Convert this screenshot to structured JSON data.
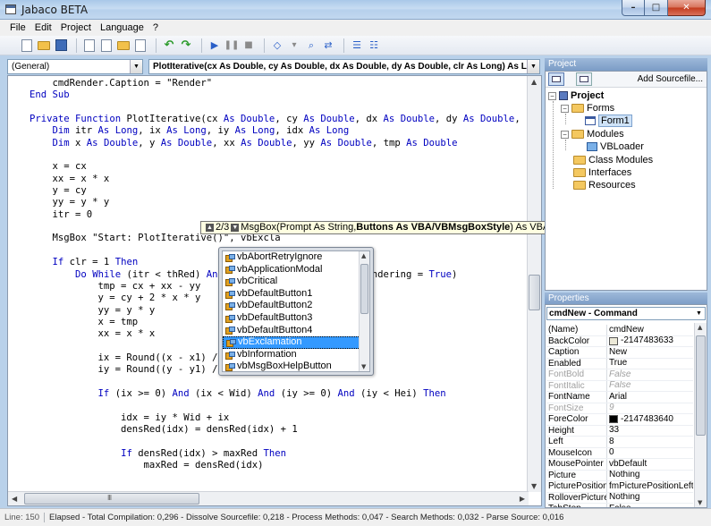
{
  "window": {
    "title": "Jabaco BETA"
  },
  "menu": [
    "File",
    "Edit",
    "Project",
    "Language",
    "?"
  ],
  "editor": {
    "object_combo": "(General)",
    "proc_combo": "PlotIterative(cx As Double, cy As Double, dx As Double, dy As Double, clr As Long) As Long",
    "code_lines": [
      "    cmdRender.Caption = \"Render\"",
      "End Sub",
      "",
      "Private Function PlotIterative(cx As Double, cy As Double, dx As Double, dy As Double, c",
      "    Dim itr As Long, ix As Long, iy As Long, idx As Long",
      "    Dim x As Double, y As Double, xx As Double, yy As Double, tmp As Double",
      "",
      "    x = cx",
      "    xx = x * x",
      "    y = cy",
      "    yy = y * y",
      "    itr = 0",
      "",
      "    MsgBox \"Start: PlotIterative()\", vbExcla",
      "",
      "    If clr = 1 Then",
      "        Do While (itr < thRed) And                       (Rendering = True)",
      "            tmp = cx + xx - yy",
      "            y = cy + 2 * x * y",
      "            yy = y * y",
      "            x = tmp",
      "            xx = x * x",
      "",
      "            ix = Round((x - x1) /",
      "            iy = Round((y - y1) /",
      "",
      "            If (ix >= 0) And (ix < Wid) And (iy >= 0) And (iy < Hei) Then",
      "",
      "                idx = iy * Wid + ix",
      "                densRed(idx) = densRed(idx) + 1",
      "",
      "                If densRed(idx) > maxRed Then",
      "                    maxRed = densRed(idx)"
    ]
  },
  "tooltip": {
    "counter": "2/3",
    "prefix": "MsgBox(Prompt As String, ",
    "bold": "Buttons As VBA/VBMsgBoxStyle",
    "suffix": ") As VBA/VBMsgBoxResult"
  },
  "autocomplete": {
    "items": [
      "vbAbortRetryIgnore",
      "vbApplicationModal",
      "vbCritical",
      "vbDefaultButton1",
      "vbDefaultButton2",
      "vbDefaultButton3",
      "vbDefaultButton4",
      "vbExclamation",
      "vbInformation",
      "vbMsgBoxHelpButton"
    ],
    "selected": "vbExclamation"
  },
  "project": {
    "header": "Project",
    "add_source": "Add Sourcefile...",
    "root": "Project",
    "nodes": {
      "forms": "Forms",
      "form1": "Form1",
      "modules": "Modules",
      "vbloader": "VBLoader",
      "class_modules": "Class Modules",
      "interfaces": "Interfaces",
      "resources": "Resources"
    }
  },
  "properties": {
    "header": "Properties",
    "object": "cmdNew - Command",
    "rows": [
      {
        "name": "(Name)",
        "value": "cmdNew"
      },
      {
        "name": "BackColor",
        "value": "-2147483633",
        "swatch": "#ece9d8"
      },
      {
        "name": "Caption",
        "value": "New"
      },
      {
        "name": "Enabled",
        "value": "True"
      },
      {
        "name": "FontBold",
        "value": "False",
        "disabled": true
      },
      {
        "name": "FontItalic",
        "value": "False",
        "disabled": true
      },
      {
        "name": "FontName",
        "value": "Arial"
      },
      {
        "name": "FontSize",
        "value": "9",
        "disabled": true
      },
      {
        "name": "ForeColor",
        "value": "-2147483640",
        "swatch": "#000000"
      },
      {
        "name": "Height",
        "value": "33"
      },
      {
        "name": "Left",
        "value": "8"
      },
      {
        "name": "MouseIcon",
        "value": "0"
      },
      {
        "name": "MousePointer",
        "value": "vbDefault"
      },
      {
        "name": "Picture",
        "value": "Nothing"
      },
      {
        "name": "PicturePosition",
        "value": "fmPicturePositionLeftCer"
      },
      {
        "name": "RolloverPicture",
        "value": "Nothing"
      },
      {
        "name": "TabStop",
        "value": "False"
      }
    ]
  },
  "status": {
    "line": "Line: 150",
    "message": "Elapsed - Total Compilation: 0,296 - Dissolve Sourcefile: 0,218 - Process Methods: 0,047 - Search Methods: 0,032 - Parse Source: 0,016"
  },
  "icons": [
    "new-project-icon",
    "open-icon",
    "save-icon",
    "cut-icon",
    "copy-icon",
    "paste-icon",
    "print-icon",
    "undo-icon",
    "redo-icon",
    "run-icon",
    "pause-icon",
    "stop-icon",
    "tag-icon",
    "find-icon",
    "replace-icon",
    "indent-icon",
    "outdent-icon"
  ]
}
